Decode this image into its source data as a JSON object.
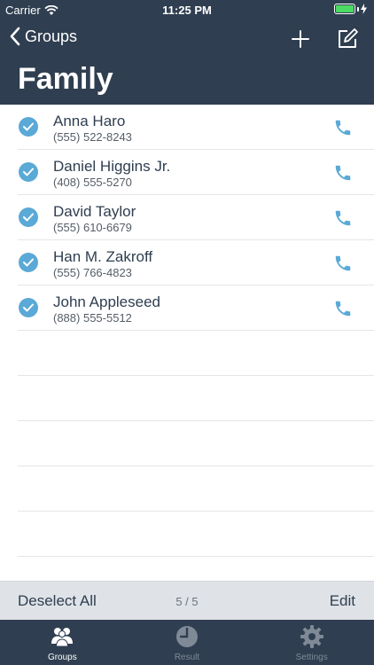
{
  "status_bar": {
    "carrier": "Carrier",
    "time": "11:25 PM"
  },
  "nav": {
    "back_label": "Groups"
  },
  "page": {
    "title": "Family"
  },
  "contacts": [
    {
      "name": "Anna Haro",
      "phone": "(555) 522-8243"
    },
    {
      "name": "Daniel Higgins Jr.",
      "phone": "(408) 555-5270"
    },
    {
      "name": "David Taylor",
      "phone": "(555) 610-6679"
    },
    {
      "name": "Han M. Zakroff",
      "phone": "(555) 766-4823"
    },
    {
      "name": "John Appleseed",
      "phone": "(888) 555-5512"
    }
  ],
  "toolbar": {
    "deselect_label": "Deselect All",
    "count": "5 / 5",
    "edit_label": "Edit"
  },
  "tabs": [
    {
      "label": "Groups",
      "icon": "groups-icon"
    },
    {
      "label": "Result",
      "icon": "result-icon"
    },
    {
      "label": "Settings",
      "icon": "settings-icon"
    }
  ],
  "colors": {
    "header": "#2f3e50",
    "accent": "#5aa9d6",
    "toolbar": "#dfe3e7"
  }
}
